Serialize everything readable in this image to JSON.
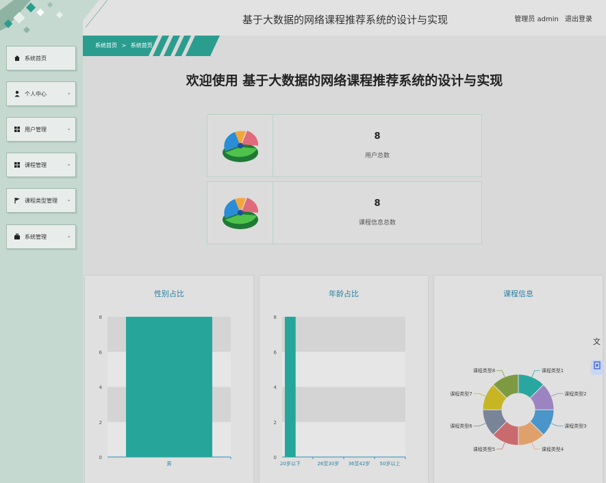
{
  "header": {
    "title": "基于大数据的网络课程推荐系统的设计与实现",
    "user_label": "管理员 admin",
    "logout_label": "退出登录"
  },
  "breadcrumb": {
    "home": "系统首页",
    "separator": ">",
    "current": "系统首页"
  },
  "sidebar": {
    "items": [
      {
        "label": "系统首页",
        "icon": "home-icon",
        "expandable": false
      },
      {
        "label": "个人中心",
        "icon": "person-icon",
        "expandable": true
      },
      {
        "label": "用户管理",
        "icon": "grid-icon",
        "expandable": true
      },
      {
        "label": "课程管理",
        "icon": "grid-icon",
        "expandable": true
      },
      {
        "label": "课程类型管理",
        "icon": "flag-icon",
        "expandable": true
      },
      {
        "label": "系统管理",
        "icon": "briefcase-icon",
        "expandable": true
      }
    ]
  },
  "main": {
    "welcome": "欢迎使用 基于大数据的网络课程推荐系统的设计与实现",
    "stats": [
      {
        "value": "8",
        "label": "用户总数",
        "icon": "pie-chart-icon"
      },
      {
        "value": "8",
        "label": "课程信息总数",
        "icon": "pie-chart-icon"
      }
    ]
  },
  "colors": {
    "sidebar": "#c6d9d0",
    "accent": "#2a9d8f",
    "bar": "#26a69a",
    "title_blue": "#2b7fa3"
  },
  "chart_data": [
    {
      "type": "bar",
      "title": "性别占比",
      "categories": [
        "男"
      ],
      "values": [
        8
      ],
      "ylim": [
        0,
        8
      ],
      "yticks": [
        0,
        2,
        4,
        6,
        8
      ]
    },
    {
      "type": "bar",
      "title": "年龄占比",
      "categories": [
        "20岁以下",
        "26至30岁",
        "36至42岁",
        "50岁以上"
      ],
      "values": [
        8,
        0,
        0,
        0
      ],
      "ylim": [
        0,
        8
      ],
      "yticks": [
        0,
        2,
        4,
        6,
        8
      ]
    },
    {
      "type": "pie",
      "title": "课程信息",
      "categories": [
        "课程类型1",
        "课程类型2",
        "课程类型3",
        "课程类型4",
        "课程类型5",
        "课程类型6",
        "课程类型7",
        "课程类型8"
      ],
      "values": [
        1,
        1,
        1,
        1,
        1,
        1,
        1,
        1
      ],
      "colors": [
        "#2aa6a0",
        "#9b84c1",
        "#4a95c9",
        "#e0a06b",
        "#c96a6e",
        "#7a8499",
        "#c8b524",
        "#7d9a43"
      ],
      "donut": true
    }
  ]
}
